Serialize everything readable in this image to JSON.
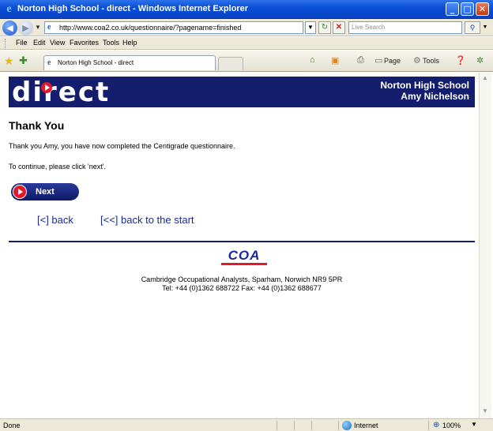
{
  "window": {
    "title": "Norton High School - direct - Windows Internet Explorer"
  },
  "address_bar": {
    "url": "http://www.coa2.co.uk/questionnaire/?pagename=finished"
  },
  "search": {
    "placeholder": "Live Search"
  },
  "menu": {
    "items": [
      "File",
      "Edit",
      "View",
      "Favorites",
      "Tools",
      "Help"
    ]
  },
  "tab": {
    "title": "Norton High School - direct"
  },
  "commands": {
    "page": "Page",
    "tools": "Tools"
  },
  "banner": {
    "logo": "direct",
    "school": "Norton High School",
    "student": "Amy Nichelson"
  },
  "page": {
    "title": "Thank You",
    "message": "Thank you Amy, you have now completed the Centigrade questionnaire.",
    "instruction": "To continue, please click 'next'.",
    "next_label": "Next",
    "back_link": "[<] back",
    "start_link": "[<<] back to the start"
  },
  "footer": {
    "logo": "COA",
    "address": "Cambridge Occupational Analysts, Sparham, Norwich NR9 5PR",
    "contact": "Tel: +44 (0)1362 688722   Fax: +44 (0)1362 688677"
  },
  "status": {
    "text": "Done",
    "zone": "Internet",
    "zoom": "100%"
  },
  "colors": {
    "banner": "#141e6c",
    "accent_red": "#e01a2a",
    "link": "#1a2a9a"
  }
}
